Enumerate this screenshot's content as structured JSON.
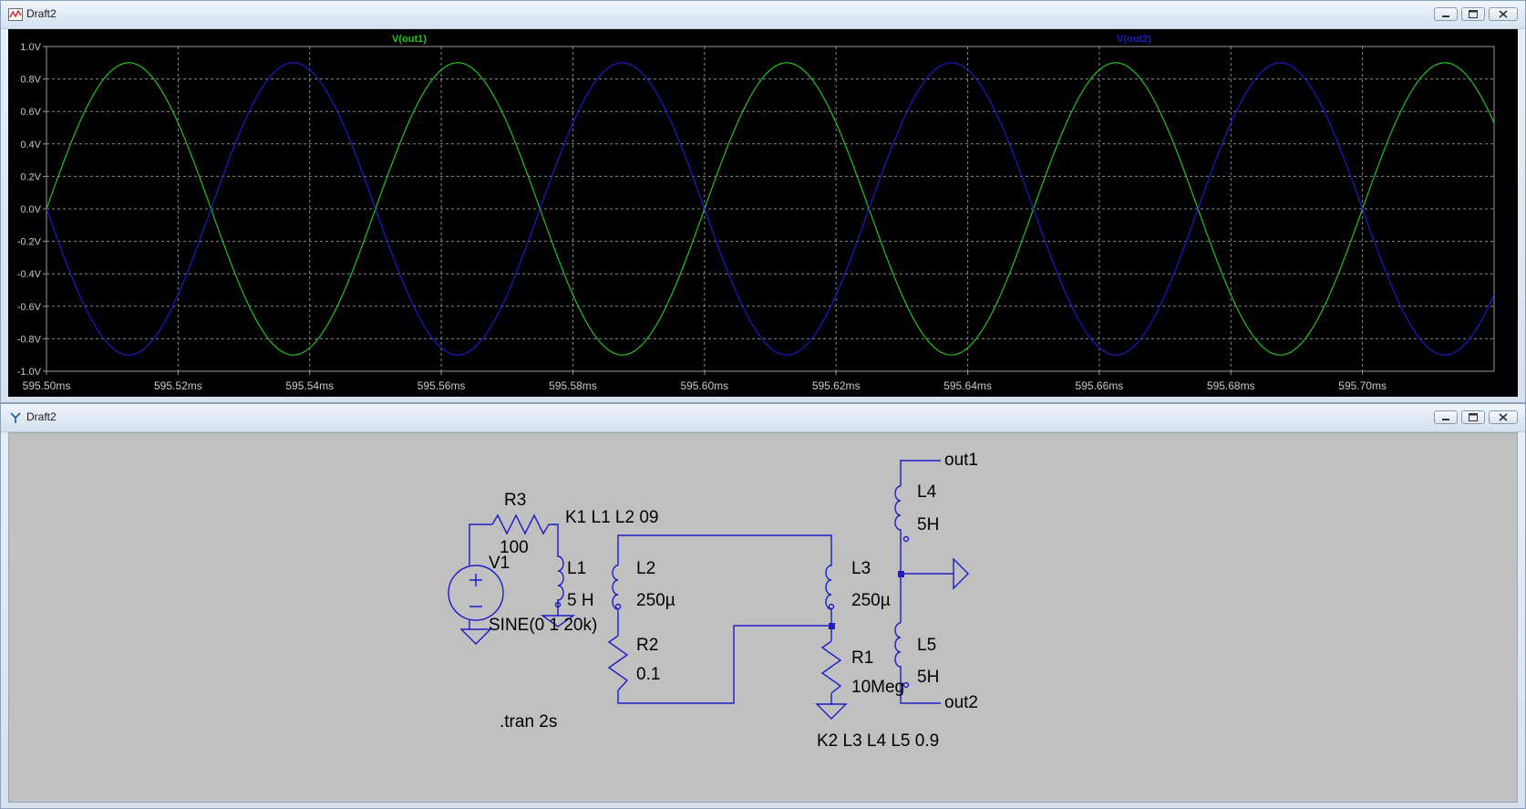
{
  "plot_window": {
    "title": "Draft2",
    "icon": "waveform-icon"
  },
  "schematic_window": {
    "title": "Draft2",
    "icon": "schematic-icon"
  },
  "window_controls": {
    "minimize": "minimize-icon",
    "maximize": "maximize-icon",
    "close": "close-icon"
  },
  "chart_data": {
    "type": "line",
    "series": [
      {
        "name": "V(out1)",
        "color": "#22c322",
        "amplitude": 0.9,
        "frequency_hz": 20000,
        "phase_deg": 0
      },
      {
        "name": "V(out2)",
        "color": "#1c1cc8",
        "amplitude": 0.9,
        "frequency_hz": 20000,
        "phase_deg": 180
      }
    ],
    "xlim_ms": [
      595.5,
      595.72
    ],
    "ylim": [
      -1.0,
      1.0
    ],
    "y_ticks": [
      "1.0V",
      "0.8V",
      "0.6V",
      "0.4V",
      "0.2V",
      "0.0V",
      "-0.2V",
      "-0.4V",
      "-0.6V",
      "-0.8V",
      "-1.0V"
    ],
    "x_ticks": [
      "595.50ms",
      "595.52ms",
      "595.54ms",
      "595.56ms",
      "595.58ms",
      "595.60ms",
      "595.62ms",
      "595.64ms",
      "595.66ms",
      "595.68ms",
      "595.70ms"
    ],
    "grid": true,
    "background": "#000000",
    "grid_color": "#8a8a8a"
  },
  "schematic": {
    "components": {
      "R3": {
        "name": "R3",
        "value": "100"
      },
      "V1": {
        "name": "V1",
        "value": "SINE(0 1 20k)"
      },
      "L1": {
        "name": "L1",
        "value": "5 H"
      },
      "L2": {
        "name": "L2",
        "value": "250µ"
      },
      "L3": {
        "name": "L3",
        "value": "250µ"
      },
      "R2": {
        "name": "R2",
        "value": "0.1"
      },
      "R1": {
        "name": "R1",
        "value": "10Meg"
      },
      "L4": {
        "name": "L4",
        "value": "5H"
      },
      "L5": {
        "name": "L5",
        "value": "5H"
      }
    },
    "directives": {
      "k1": "K1 L1 L2 09",
      "k2": "K2 L3 L4 L5 0.9",
      "tran": ".tran 2s"
    },
    "nets": {
      "out1": "out1",
      "out2": "out2"
    },
    "wire_color": "#1c1cc8",
    "text_color": "#000000"
  }
}
